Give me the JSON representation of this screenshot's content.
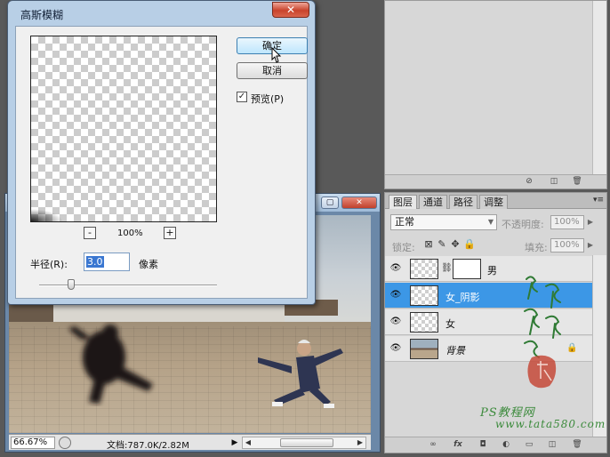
{
  "dialog": {
    "title": "高斯模糊",
    "close_icon": "close-icon",
    "ok_label": "确定",
    "cancel_label": "取消",
    "preview_label": "预览(P)",
    "preview_checked": true,
    "zoom_out_label": "-",
    "zoom_in_label": "+",
    "zoom_level": "100%",
    "radius_label": "半径(R):",
    "radius_value": "3.0",
    "radius_unit": "像素"
  },
  "document": {
    "zoom": "66.67%",
    "info": "文档:787.0K/2.82M",
    "status_arrow": "▶",
    "scroll_left": "◀",
    "scroll_right": "▶"
  },
  "layers_panel": {
    "tabs": [
      "图层",
      "通道",
      "路径",
      "调整"
    ],
    "active_tab": "图层",
    "blend_mode": "正常",
    "opacity_label": "不透明度:",
    "opacity_value": "100%",
    "lock_label": "锁定:",
    "fill_label": "填充:",
    "fill_value": "100%",
    "layers": [
      {
        "name": "男",
        "visible": true,
        "has_mask": true,
        "selected": false
      },
      {
        "name": "女_阴影",
        "visible": true,
        "has_mask": false,
        "selected": true
      },
      {
        "name": "女",
        "visible": true,
        "has_mask": false,
        "selected": false
      },
      {
        "name": "背景",
        "visible": true,
        "has_mask": false,
        "selected": false,
        "locked": true
      }
    ],
    "footer_icons": [
      "link-icon",
      "fx-icon",
      "mask-icon",
      "adjustment-icon",
      "group-icon",
      "new-layer-icon",
      "trash-icon"
    ]
  },
  "watermark": {
    "site_line1": "PS教程网",
    "site_line2": "www.tata580.com"
  },
  "colors": {
    "selection": "#3c97e6",
    "dialog_frame": "#b8cfe6",
    "close_button": "#c9432c",
    "watermark": "#3b8a3b"
  }
}
